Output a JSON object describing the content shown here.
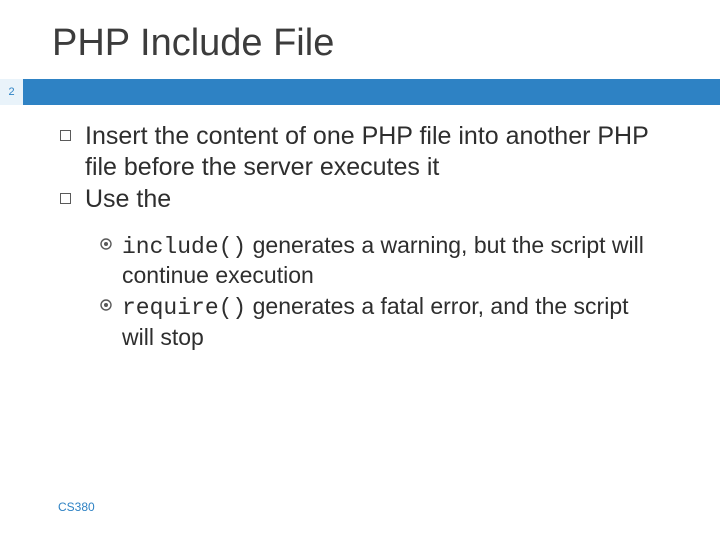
{
  "title": "PHP Include File",
  "page_number": "2",
  "bullets": [
    {
      "text": "Insert the content of one PHP file into another PHP file before the server executes it"
    },
    {
      "text": "Use the"
    }
  ],
  "sub_bullets": [
    {
      "code": "include()",
      "text": " generates a warning, but the script will continue execution"
    },
    {
      "code": "require()",
      "text": " generates a fatal error, and the script will stop"
    }
  ],
  "footer": "CS380",
  "chart_data": null
}
